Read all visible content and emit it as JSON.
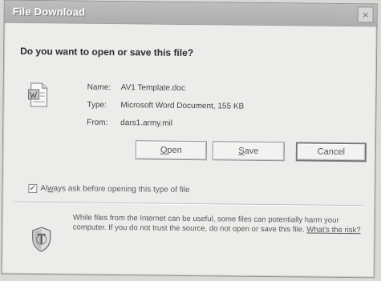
{
  "window": {
    "title": "File Download",
    "close_symbol": "×"
  },
  "dialog": {
    "question": "Do you want to open or save this file?",
    "file": {
      "icon": "document-icon",
      "name_label": "Name:",
      "name_value": "AV1 Template.doc",
      "type_label": "Type:",
      "type_value": "Microsoft Word Document, 155 KB",
      "from_label": "From:",
      "from_value": "dars1.army.mil"
    },
    "buttons": {
      "open": {
        "mnemonic": "O",
        "rest": "pen"
      },
      "save": {
        "mnemonic": "S",
        "rest": "ave"
      },
      "cancel": "Cancel"
    },
    "checkbox": {
      "checked": true,
      "mark": "✓",
      "label_mnemonic": "w",
      "label_prefix": "Al",
      "label_suffix": "ays ask before opening this type of file"
    },
    "warning": {
      "icon": "shield-icon",
      "text": "While files from the Internet can be useful, some files can potentially harm your computer. If you do not trust the source, do not open or save this file.",
      "link": "What's the risk?"
    }
  }
}
